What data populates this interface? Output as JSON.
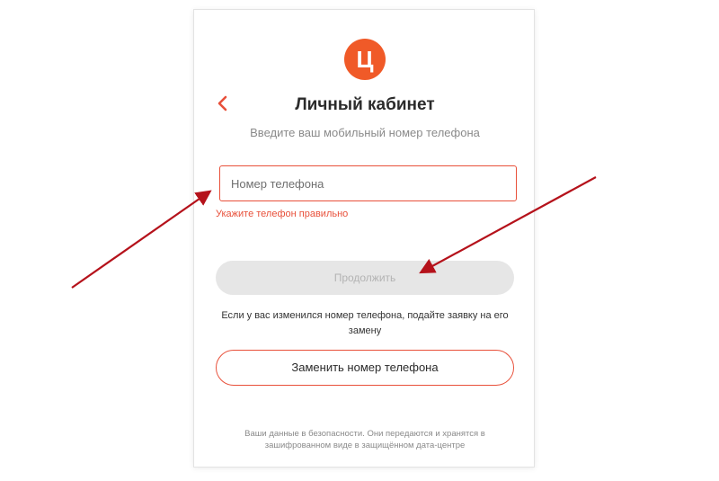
{
  "logo": {
    "letter": "Ц",
    "color": "#f05a28"
  },
  "header": {
    "back_icon": "chevron-left-icon",
    "title": "Личный кабинет",
    "subtitle": "Введите ваш мобильный номер телефона"
  },
  "form": {
    "phone_placeholder": "Номер телефона",
    "phone_value": "",
    "error": "Укажите телефон правильно",
    "continue_label": "Продолжить",
    "continue_enabled": false
  },
  "change_number": {
    "info": "Если у вас изменился номер телефона, подайте заявку на его замену",
    "button_label": "Заменить номер телефона"
  },
  "footer": {
    "security_note": "Ваши данные в безопасности. Они передаются и хранятся в зашифрованном виде в защищённом дата-центре"
  },
  "colors": {
    "accent": "#f05a28",
    "error": "#e8503a",
    "annotation_arrow": "#b5121b"
  }
}
